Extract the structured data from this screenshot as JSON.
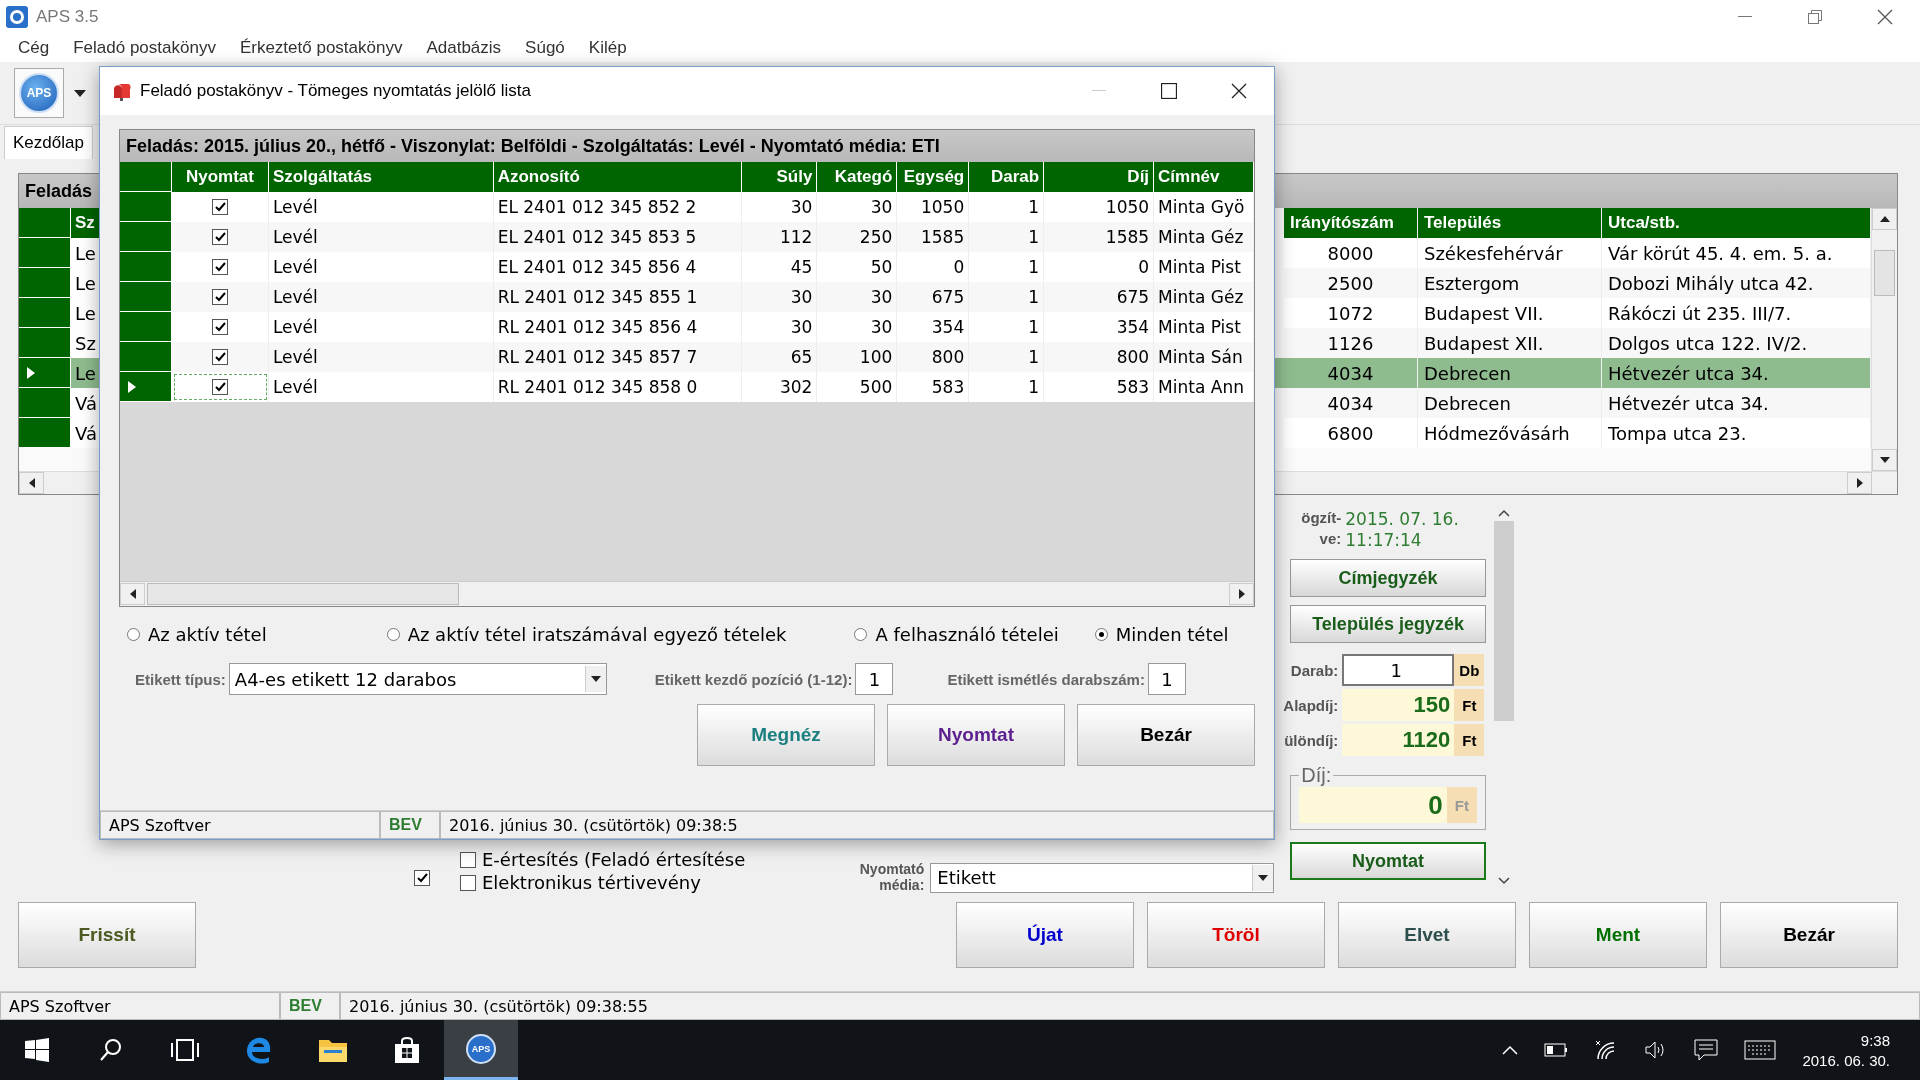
{
  "window": {
    "title": "APS 3.5"
  },
  "menu": [
    "Cég",
    "Feladó postakönyv",
    "Érkeztető postakönyv",
    "Adatbázis",
    "Súgó",
    "Kilép"
  ],
  "toolbar": {
    "logo_text": "APS"
  },
  "tabs": [
    {
      "label": "Kezdőlap",
      "selected": true
    }
  ],
  "main_grid": {
    "caption": "Feladás",
    "first_column": "Sz",
    "columns": [
      "Irányítószám",
      "Település",
      "Utca/stb."
    ],
    "rows": [
      {
        "first": "Le",
        "cells": [
          "8000",
          "Székesfehérvár",
          "Vár körút 45. 4. em. 5. a."
        ],
        "selected": false
      },
      {
        "first": "Le",
        "cells": [
          "2500",
          "Esztergom",
          "Dobozi Mihály utca 42."
        ],
        "selected": false
      },
      {
        "first": "Le",
        "cells": [
          "1072",
          "Budapest VII.",
          "Rákóczi út 235. III/7."
        ],
        "selected": false
      },
      {
        "first": "Sz",
        "cells": [
          "1126",
          "Budapest XII.",
          "Dolgos utca 122. IV/2."
        ],
        "selected": false
      },
      {
        "first": "Le",
        "cells": [
          "4034",
          "Debrecen",
          "Hétvezér utca 34."
        ],
        "selected": true
      },
      {
        "first": "Vá",
        "cells": [
          "4034",
          "Debrecen",
          "Hétvezér utca 34."
        ],
        "selected": false
      },
      {
        "first": "Vá",
        "cells": [
          "6800",
          "Hódmezővásárh",
          "Tompa utca 23."
        ],
        "selected": false
      }
    ]
  },
  "record_panel": {
    "recorded_label": [
      "ögzít-",
      "ve:"
    ],
    "recorded_date": "2015. 07. 16.",
    "recorded_time": "11:17:14",
    "buttons": [
      "Címjegyzék",
      "Település jegyzék"
    ],
    "amounts": [
      {
        "label": "Darab:",
        "value": "1",
        "unit": "Db",
        "kind": "input"
      },
      {
        "label": "Alapdíj:",
        "value": "150",
        "unit": "Ft",
        "kind": "fee"
      },
      {
        "label": "ülöndíj:",
        "value": "1120",
        "unit": "Ft",
        "kind": "fee"
      }
    ],
    "total": {
      "legend": "Díj:",
      "value": "0",
      "unit": "Ft"
    },
    "print_button": "Nyomtat"
  },
  "form": {
    "lone_checkbox": {
      "checked": true
    },
    "options": [
      {
        "label": "E-értesítés (Feladó értesítése",
        "checked": false
      },
      {
        "label": "Elektronikus tértivevény",
        "checked": false
      }
    ],
    "media": {
      "label": "Nyomtató média:",
      "value": "Etikett"
    }
  },
  "actions": [
    {
      "label": "Frissít",
      "color": "#4b5a20"
    },
    {
      "label": "Újat",
      "color": "#0000cc"
    },
    {
      "label": "Töröl",
      "color": "#e00000"
    },
    {
      "label": "Elvet",
      "color": "#2f4f4f"
    },
    {
      "label": "Ment",
      "color": "#007000"
    },
    {
      "label": "Bezár",
      "color": "#000000"
    }
  ],
  "status_bar": [
    "APS Szoftver",
    "BEV",
    "2016. június 30. (csütörtök) 09:38:55"
  ],
  "dialog": {
    "title": "Feladó postakönyv - Tömeges nyomtatás jelölő lista",
    "caption": "Feladás: 2015. július 20., hétfő - Viszonylat: Belföldi - Szolgáltatás: Levél - Nyomtató média: ETI",
    "check_column": "Nyomtat",
    "columns": [
      "Szolgáltatás",
      "Azonosító",
      "Súly",
      "Kategó",
      "Egység",
      "Darab",
      "Díj",
      "Címnév"
    ],
    "rows": [
      {
        "checked": true,
        "selected": false,
        "cells": [
          "Levél",
          "EL 2401 012 345 852 2",
          "30",
          "30",
          "1050",
          "1",
          "1050",
          "Minta Gyö"
        ]
      },
      {
        "checked": true,
        "selected": false,
        "cells": [
          "Levél",
          "EL 2401 012 345 853 5",
          "112",
          "250",
          "1585",
          "1",
          "1585",
          "Minta Géz"
        ]
      },
      {
        "checked": true,
        "selected": false,
        "cells": [
          "Levél",
          "EL 2401 012 345 856 4",
          "45",
          "50",
          "0",
          "1",
          "0",
          "Minta Pist"
        ]
      },
      {
        "checked": true,
        "selected": false,
        "cells": [
          "Levél",
          "RL 2401 012 345 855 1",
          "30",
          "30",
          "675",
          "1",
          "675",
          "Minta Géz"
        ]
      },
      {
        "checked": true,
        "selected": false,
        "cells": [
          "Levél",
          "RL 2401 012 345 856 4",
          "30",
          "30",
          "354",
          "1",
          "354",
          "Minta Pist"
        ]
      },
      {
        "checked": true,
        "selected": false,
        "cells": [
          "Levél",
          "RL 2401 012 345 857 7",
          "65",
          "100",
          "800",
          "1",
          "800",
          "Minta Sán"
        ]
      },
      {
        "checked": true,
        "selected": true,
        "cells": [
          "Levél",
          "RL 2401 012 345 858 0",
          "302",
          "500",
          "583",
          "1",
          "583",
          "Minta Ann"
        ]
      }
    ],
    "radios": [
      {
        "label": "Az aktív tétel",
        "selected": false
      },
      {
        "label": "Az aktív tétel iratszámával egyező tételek",
        "selected": false
      },
      {
        "label": "A felhasználó tételei",
        "selected": false
      },
      {
        "label": "Minden tétel",
        "selected": true
      }
    ],
    "label_type": {
      "label": "Etikett típus:",
      "value": "A4-es etikett 12 darabos"
    },
    "start_position": {
      "label": "Etikett kezdő pozíció (1-12):",
      "value": "1"
    },
    "repeat_count": {
      "label": "Etikett ismétlés darabszám:",
      "value": "1"
    },
    "buttons": [
      {
        "label": "Megnéz",
        "color": "#1b7f7f"
      },
      {
        "label": "Nyomtat",
        "color": "#5b1f8f"
      },
      {
        "label": "Bezár",
        "color": "#000000"
      }
    ],
    "status_bar": [
      "APS Szoftver",
      "BEV",
      "2016. június 30. (csütörtök) 09:38:5"
    ]
  },
  "taskbar": {
    "apps": [
      {
        "kind": "start",
        "selected": false
      },
      {
        "kind": "search",
        "selected": false
      },
      {
        "kind": "taskview",
        "selected": false
      },
      {
        "kind": "browser",
        "selected": false
      },
      {
        "kind": "folder",
        "selected": false
      },
      {
        "kind": "store",
        "selected": false
      },
      {
        "kind": "aps",
        "selected": true
      }
    ],
    "aps_text": "APS",
    "time": "9:38",
    "date": "2016. 06. 30."
  }
}
